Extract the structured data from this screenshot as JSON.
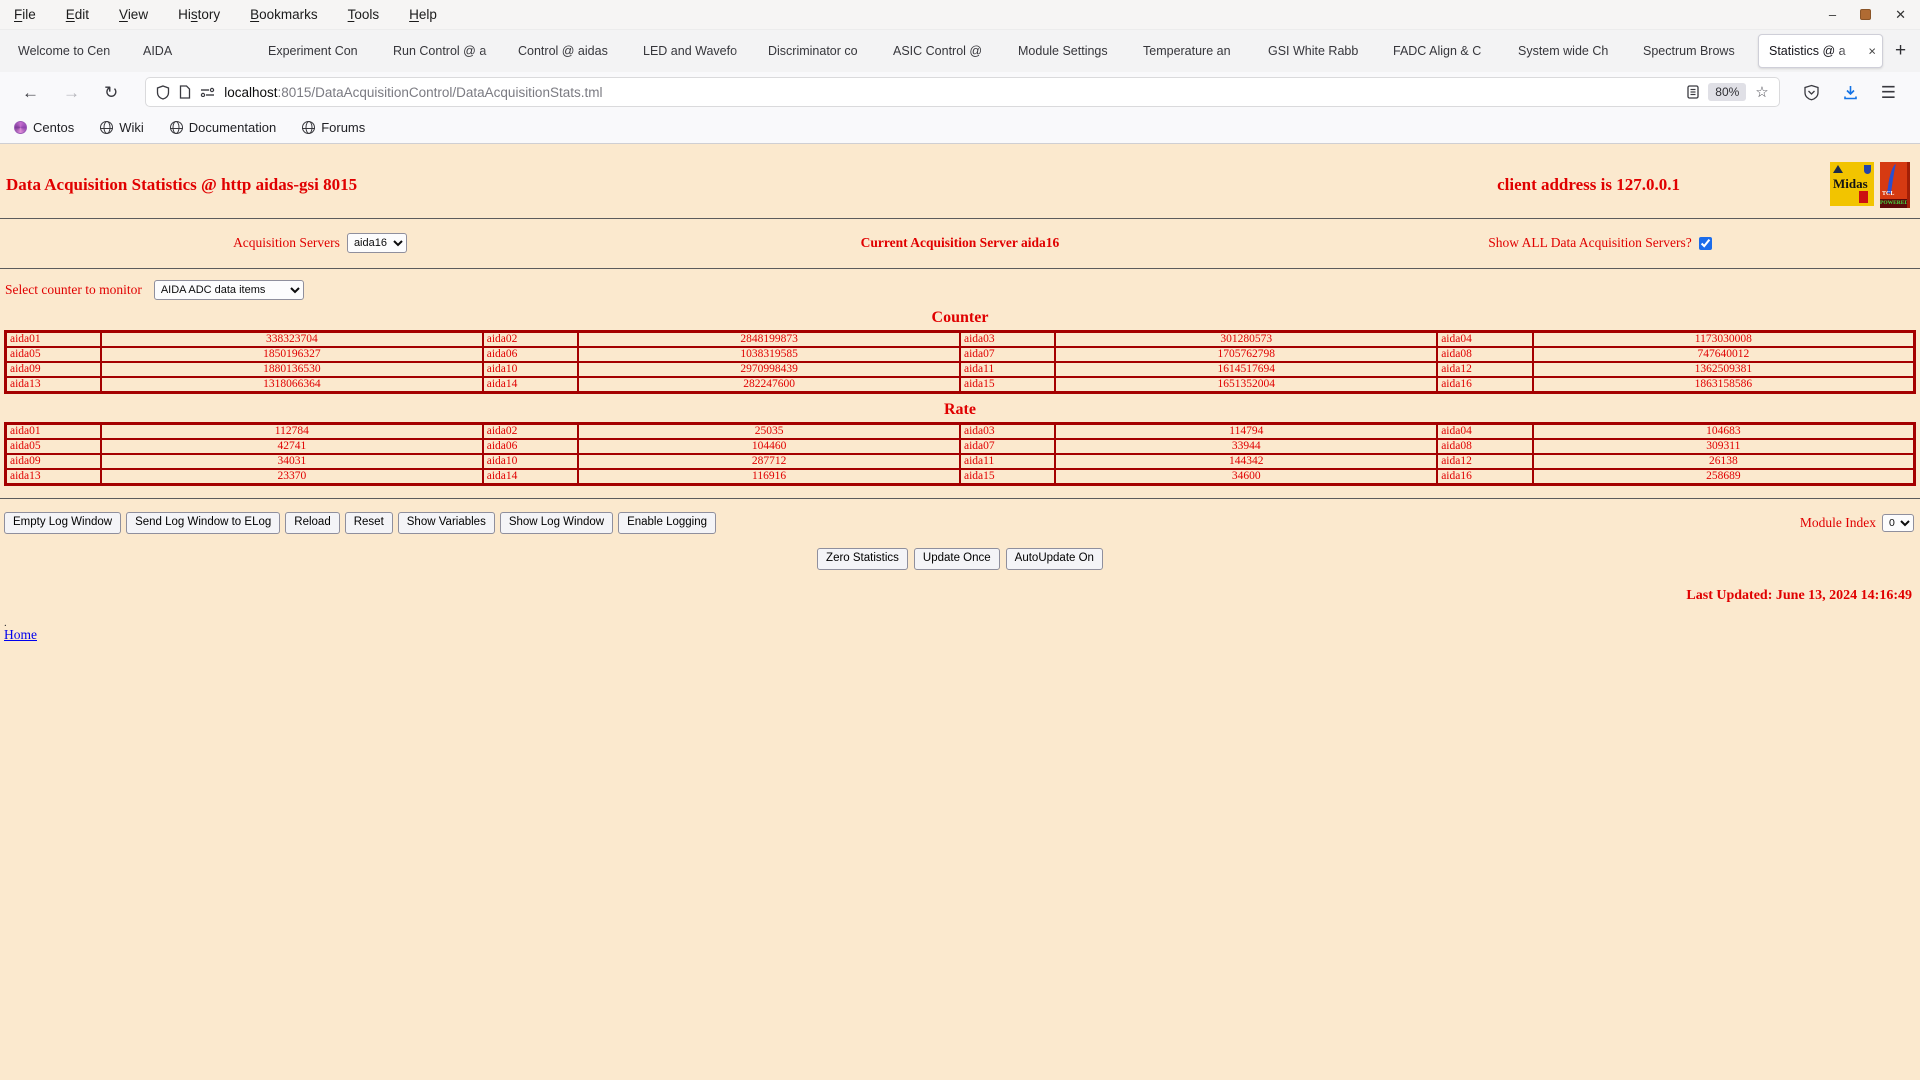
{
  "window": {
    "menu_items": [
      {
        "label": "File",
        "accesskey": "F"
      },
      {
        "label": "Edit",
        "accesskey": "E"
      },
      {
        "label": "View",
        "accesskey": "V"
      },
      {
        "label": "History",
        "accesskey": "s"
      },
      {
        "label": "Bookmarks",
        "accesskey": "B"
      },
      {
        "label": "Tools",
        "accesskey": "T"
      },
      {
        "label": "Help",
        "accesskey": "H"
      }
    ]
  },
  "tabs": {
    "items": [
      "Welcome to Cen",
      "AIDA",
      "Experiment Con",
      "Run Control @ a",
      "Control @ aidas",
      "LED and Wavefo",
      "Discriminator co",
      "ASIC Control @",
      "Module Settings",
      "Temperature an",
      "GSI White Rabb",
      "FADC Align & C",
      "System wide Ch",
      "Spectrum Brows",
      "Statistics @ a"
    ],
    "active_index": 14,
    "close_glyph": "×",
    "new_tab_glyph": "+"
  },
  "navbar": {
    "url_host": "localhost",
    "url_rest": ":8015/DataAcquisitionControl/DataAcquisitionStats.tml",
    "zoom_level": "80%"
  },
  "bookmarks": {
    "items": [
      {
        "label": "Centos",
        "icon": "centos"
      },
      {
        "label": "Wiki",
        "icon": "globe"
      },
      {
        "label": "Documentation",
        "icon": "globe"
      },
      {
        "label": "Forums",
        "icon": "globe"
      }
    ]
  },
  "page": {
    "title": "Data Acquisition Statistics @ http aidas-gsi 8015",
    "client_address": "client address is 127.0.0.1",
    "acquisition_servers": {
      "label": "Acquisition Servers",
      "selected": "aida16"
    },
    "current_server_text": "Current Acquisition Server aida16",
    "show_all": {
      "label": "Show ALL Data Acquisition Servers?",
      "checked": true
    },
    "counter_monitor": {
      "label": "Select counter to monitor",
      "selected": "AIDA ADC data items"
    },
    "counter_section": {
      "heading": "Counter",
      "rows": [
        [
          "aida01",
          "338323704",
          "aida02",
          "2848199873",
          "aida03",
          "301280573",
          "aida04",
          "1173030008"
        ],
        [
          "aida05",
          "1850196327",
          "aida06",
          "1038319585",
          "aida07",
          "1705762798",
          "aida08",
          "747640012"
        ],
        [
          "aida09",
          "1880136530",
          "aida10",
          "2970998439",
          "aida11",
          "1614517694",
          "aida12",
          "1362509381"
        ],
        [
          "aida13",
          "1318066364",
          "aida14",
          "282247600",
          "aida15",
          "1651352004",
          "aida16",
          "1863158586"
        ]
      ]
    },
    "rate_section": {
      "heading": "Rate",
      "rows": [
        [
          "aida01",
          "112784",
          "aida02",
          "25035",
          "aida03",
          "114794",
          "aida04",
          "104683"
        ],
        [
          "aida05",
          "42741",
          "aida06",
          "104460",
          "aida07",
          "33944",
          "aida08",
          "309311"
        ],
        [
          "aida09",
          "34031",
          "aida10",
          "287712",
          "aida11",
          "144342",
          "aida12",
          "26138"
        ],
        [
          "aida13",
          "23370",
          "aida14",
          "116916",
          "aida15",
          "34600",
          "aida16",
          "258689"
        ]
      ]
    },
    "log_buttons": [
      "Empty Log Window",
      "Send Log Window to ELog",
      "Reload",
      "Reset",
      "Show Variables",
      "Show Log Window",
      "Enable Logging"
    ],
    "module_index": {
      "label": "Module Index",
      "selected": "0"
    },
    "update_buttons": [
      "Zero Statistics",
      "Update Once",
      "AutoUpdate On"
    ],
    "last_updated": "Last Updated: June 13, 2024 14:16:49",
    "footer": {
      "dot": ".",
      "home_link": "Home"
    },
    "logos": {
      "midas": "Midas",
      "tcl": "TCL",
      "tcl_band": "POWERED"
    }
  },
  "colors": {
    "page_bg": "#fbe9ce",
    "text_red": "#e00000",
    "border_red": "#a40000",
    "link_blue": "#0000ee",
    "checkbox_blue": "#1b6ceb"
  }
}
